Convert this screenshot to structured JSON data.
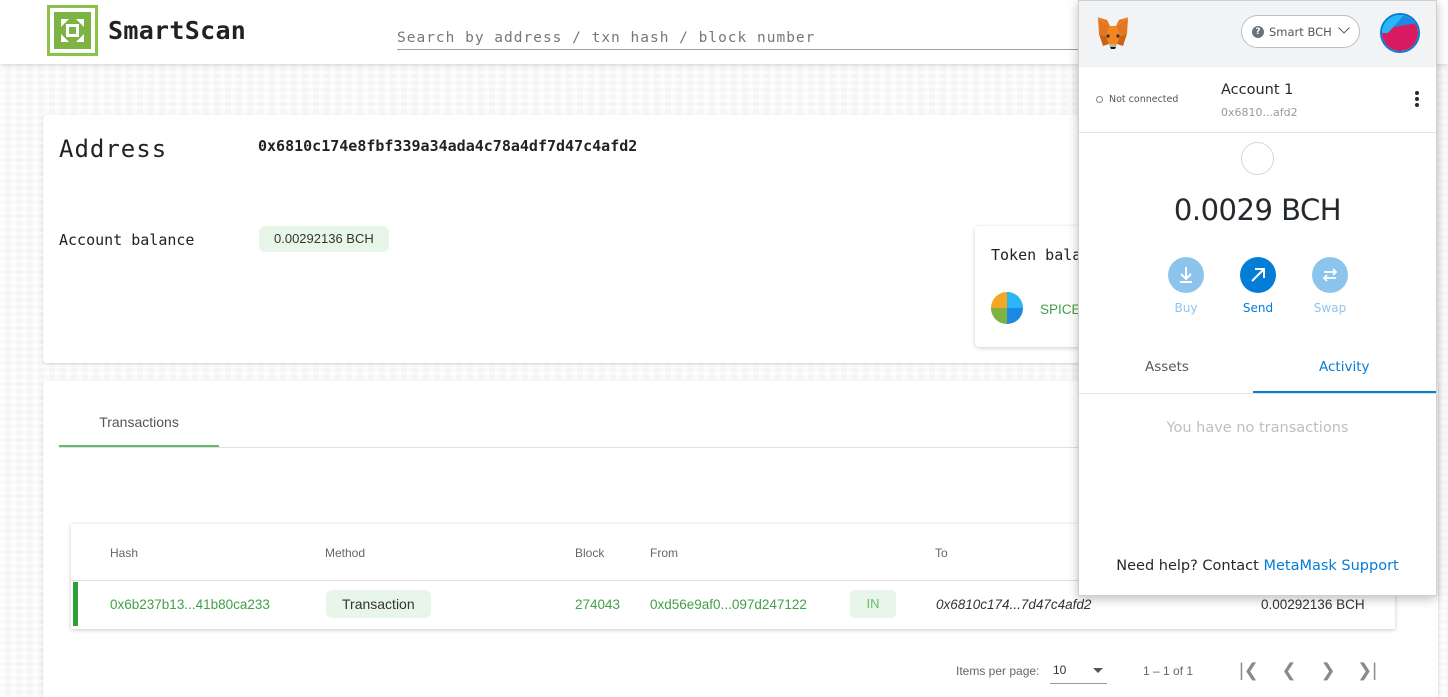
{
  "header": {
    "brand": "SmartScan",
    "search_placeholder": "Search by address / txn hash / block number"
  },
  "address_card": {
    "label": "Address",
    "address": "0x6810c174e8fbf339a34ada4c78a4df7d47c4afd2",
    "balance_label": "Account balance",
    "balance_value": "0.00292136 BCH",
    "token_title": "Token balances",
    "token_name": "SPICE"
  },
  "transactions": {
    "tab_label": "Transactions",
    "headers": {
      "hash": "Hash",
      "method": "Method",
      "block": "Block",
      "from": "From",
      "to": "To"
    },
    "rows": [
      {
        "hash": "0x6b237b13...41b80ca233",
        "method": "Transaction",
        "block": "274043",
        "from": "0xd56e9af0...097d247122",
        "direction": "IN",
        "to": "0x6810c174...7d47c4afd2",
        "value": "0.00292136 BCH"
      }
    ],
    "pager": {
      "items_per_page_label": "Items per page:",
      "items_per_page": "10",
      "range": "1 – 1 of 1"
    }
  },
  "metamask": {
    "network": "Smart BCH",
    "connection_status": "Not connected",
    "account_name": "Account 1",
    "account_address": "0x6810...afd2",
    "balance": "0.0029 BCH",
    "actions": {
      "buy": "Buy",
      "send": "Send",
      "swap": "Swap"
    },
    "tabs": {
      "assets": "Assets",
      "activity": "Activity"
    },
    "empty_text": "You have no transactions",
    "help_prefix": "Need help? Contact",
    "help_link": "MetaMask Support"
  },
  "colors": {
    "accent_green": "#43a047",
    "chip_green": "#e8f6e9",
    "metamask_blue": "#037dd6",
    "metamask_light_blue": "#8dc4ee"
  }
}
